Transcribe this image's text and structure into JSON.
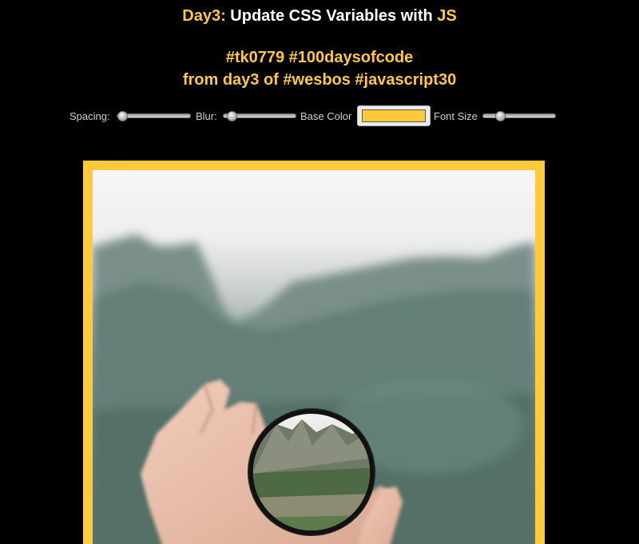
{
  "header": {
    "day_label": "Day3:",
    "title_main": " Update CSS Variables with ",
    "title_js": "JS",
    "line2": "#tk0779 #100daysofcode",
    "line3": "from day3 of #wesbos #javascript30"
  },
  "controls": {
    "spacing_label": "Spacing:",
    "spacing_level": 0,
    "blur_label": "Blur:",
    "blur_level": 0.05,
    "base_color_label": "Base Color",
    "base_color_value": "#ffc93c",
    "font_size_label": "Font Size",
    "font_size_level": 0.2
  },
  "colors": {
    "background": "#000000",
    "accent": "#ffc93c",
    "title_text": "#ffffff"
  }
}
